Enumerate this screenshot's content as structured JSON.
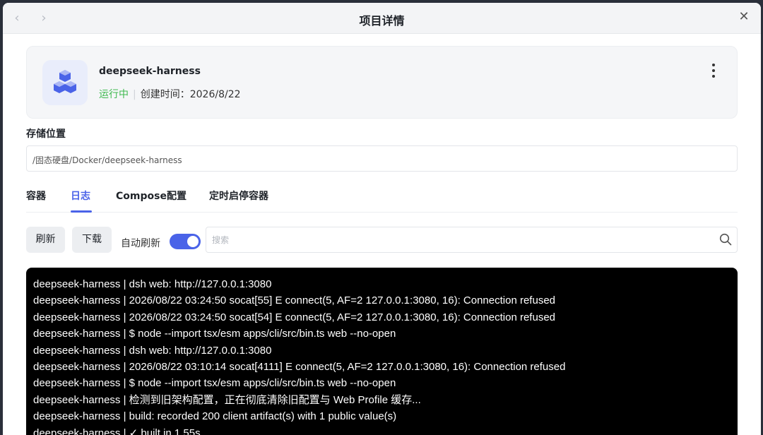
{
  "window": {
    "title": "项目详情",
    "back_glyph": "‹",
    "forward_glyph": "›",
    "close_glyph": "✕"
  },
  "project": {
    "name": "deepseek-harness",
    "status": "运行中",
    "separator": "|",
    "created_label": "创建时间：",
    "created_date": "2026/8/22",
    "icon": "cubes-icon"
  },
  "storage": {
    "label": "存储位置",
    "path": "/固态硬盘/Docker/deepseek-harness"
  },
  "tabs": [
    {
      "label": "容器",
      "active": false
    },
    {
      "label": "日志",
      "active": true
    },
    {
      "label": "Compose配置",
      "active": false
    },
    {
      "label": "定时启停容器",
      "active": false
    }
  ],
  "toolbar": {
    "refresh_label": "刷新",
    "download_label": "下载",
    "auto_refresh_label": "自动刷新",
    "auto_refresh_on": true,
    "search_placeholder": "搜索",
    "search_value": ""
  },
  "logs": [
    "deepseek-harness | dsh web: http://127.0.0.1:3080",
    "deepseek-harness | 2026/08/22 03:24:50 socat[55] E connect(5, AF=2 127.0.0.1:3080, 16): Connection refused",
    "deepseek-harness | 2026/08/22 03:24:50 socat[54] E connect(5, AF=2 127.0.0.1:3080, 16): Connection refused",
    "deepseek-harness | $ node --import tsx/esm apps/cli/src/bin.ts web --no-open",
    "deepseek-harness | dsh web: http://127.0.0.1:3080",
    "deepseek-harness | 2026/08/22 03:10:14 socat[4111] E connect(5, AF=2 127.0.0.1:3080, 16): Connection refused",
    "deepseek-harness | $ node --import tsx/esm apps/cli/src/bin.ts web --no-open",
    "deepseek-harness | 检测到旧架构配置，正在彻底清除旧配置与 Web Profile 缓存...",
    "deepseek-harness | build: recorded 200 client artifact(s) with 1 public value(s)",
    "deepseek-harness | ✓ built in 1.55s"
  ],
  "colors": {
    "accent": "#4a63e8",
    "running": "#3fb950",
    "log_background": "#000000"
  }
}
